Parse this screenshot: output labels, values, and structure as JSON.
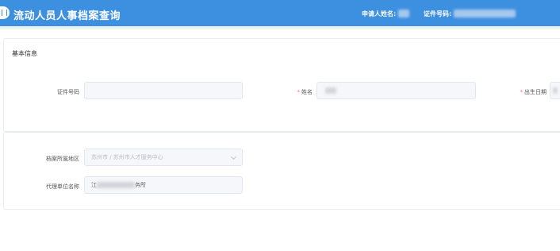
{
  "header": {
    "title": "流动人员人事档案查询",
    "applicant_label": "申请人姓名:",
    "id_label": "证件号码:"
  },
  "basic_info": {
    "section_title": "基本信息",
    "id_number": {
      "label": "证件号码",
      "value": "",
      "required": false
    },
    "name": {
      "label": "姓名",
      "value": "",
      "required": true
    },
    "birth_date": {
      "label": "出生日期",
      "value": "",
      "required": true
    }
  },
  "archive": {
    "region": {
      "label": "档案所属地区",
      "placeholder": "苏州市 / 苏州市人才服务中心"
    },
    "agency": {
      "label": "代理单位名称",
      "value_prefix": "江",
      "value_suffix": "务所"
    }
  },
  "colors": {
    "header_bg": "#3d8fe0",
    "required": "#f56c6c",
    "input_bg": "#f5f7fa"
  }
}
